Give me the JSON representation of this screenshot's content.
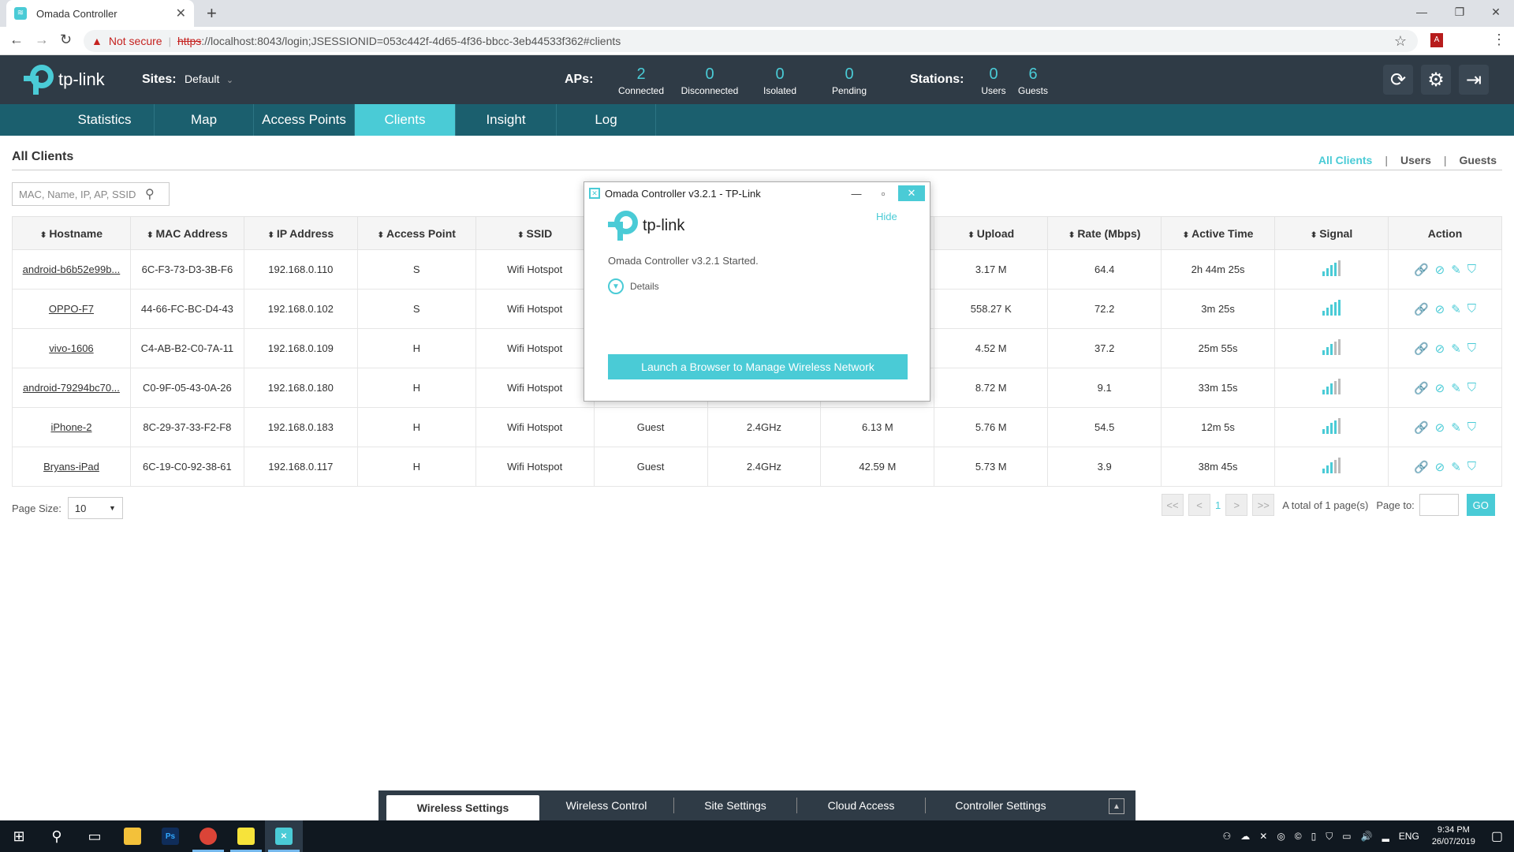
{
  "browser": {
    "tab_title": "Omada Controller",
    "not_secure": "Not secure",
    "url_scheme": "https",
    "url_rest": "://localhost:8043/login;JSESSIONID=053c442f-4d65-4f36-bbcc-3eb44533f362#clients"
  },
  "header": {
    "logo_text": "tp-link",
    "sites_label": "Sites:",
    "sites_value": "Default",
    "aps_label": "APs:",
    "aps": [
      {
        "num": "2",
        "label": "Connected"
      },
      {
        "num": "0",
        "label": "Disconnected"
      },
      {
        "num": "0",
        "label": "Isolated"
      },
      {
        "num": "0",
        "label": "Pending"
      }
    ],
    "stations_label": "Stations:",
    "stations": [
      {
        "num": "0",
        "label": "Users"
      },
      {
        "num": "6",
        "label": "Guests"
      }
    ]
  },
  "nav": [
    "Statistics",
    "Map",
    "Access Points",
    "Clients",
    "Insight",
    "Log"
  ],
  "content": {
    "title": "All Clients",
    "filters": [
      "All Clients",
      "Users",
      "Guests"
    ],
    "search_placeholder": "MAC, Name, IP, AP, SSID"
  },
  "table": {
    "headers": [
      "Hostname",
      "MAC Address",
      "IP Address",
      "Access Point",
      "SSID",
      "",
      "",
      "",
      "Upload",
      "Rate (Mbps)",
      "Active Time",
      "Signal",
      "Action"
    ],
    "rows": [
      {
        "host": "android-b6b52e99b...",
        "mac": "6C-F3-73-D3-3B-F6",
        "ip": "192.168.0.110",
        "ap": "S",
        "ssid": "Wifi Hotspot",
        "type": "",
        "band": "",
        "down": "",
        "up": "3.17 M",
        "rate": "64.4",
        "time": "2h 44m 25s"
      },
      {
        "host": "OPPO-F7",
        "mac": "44-66-FC-BC-D4-43",
        "ip": "192.168.0.102",
        "ap": "S",
        "ssid": "Wifi Hotspot",
        "type": "",
        "band": "",
        "down": "",
        "up": "558.27 K",
        "rate": "72.2",
        "time": "3m 25s"
      },
      {
        "host": "vivo-1606",
        "mac": "C4-AB-B2-C0-7A-11",
        "ip": "192.168.0.109",
        "ap": "H",
        "ssid": "Wifi Hotspot",
        "type": "",
        "band": "",
        "down": "",
        "up": "4.52 M",
        "rate": "37.2",
        "time": "25m 55s"
      },
      {
        "host": "android-79294bc70...",
        "mac": "C0-9F-05-43-0A-26",
        "ip": "192.168.0.180",
        "ap": "H",
        "ssid": "Wifi Hotspot",
        "type": "",
        "band": "",
        "down": "",
        "up": "8.72 M",
        "rate": "9.1",
        "time": "33m 15s"
      },
      {
        "host": "iPhone-2",
        "mac": "8C-29-37-33-F2-F8",
        "ip": "192.168.0.183",
        "ap": "H",
        "ssid": "Wifi Hotspot",
        "type": "Guest",
        "band": "2.4GHz",
        "down": "6.13 M",
        "up": "5.76 M",
        "rate": "54.5",
        "time": "12m 5s"
      },
      {
        "host": "Bryans-iPad",
        "mac": "6C-19-C0-92-38-61",
        "ip": "192.168.0.117",
        "ap": "H",
        "ssid": "Wifi Hotspot",
        "type": "Guest",
        "band": "2.4GHz",
        "down": "42.59 M",
        "up": "5.73 M",
        "rate": "3.9",
        "time": "38m 45s"
      }
    ]
  },
  "pagination": {
    "page_size_label": "Page Size:",
    "page_size_value": "10",
    "first": "<<",
    "prev": "<",
    "current": "1",
    "next": ">",
    "last": ">>",
    "total_text": "A total of 1 page(s)",
    "page_to_label": "Page to:",
    "go": "GO"
  },
  "dialog": {
    "title": "Omada Controller v3.2.1 - TP-Link",
    "hide": "Hide",
    "status": "Omada Controller v3.2.1 Started.",
    "details": "Details",
    "launch": "Launch a Browser to Manage Wireless Network"
  },
  "settings_bar": [
    "Wireless Settings",
    "Wireless Control",
    "Site Settings",
    "Cloud Access",
    "Controller Settings"
  ],
  "taskbar": {
    "lang": "ENG",
    "time": "9:34 PM",
    "date": "26/07/2019"
  },
  "colors": {
    "accent": "#4acbd6",
    "header_bg": "#2f3b46",
    "nav_bg": "#1b5f6e"
  }
}
